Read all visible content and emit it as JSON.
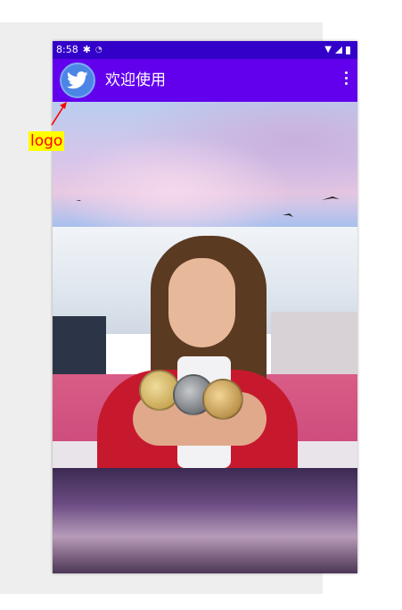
{
  "status_bar": {
    "time": "8:58",
    "icons": [
      "gear-icon",
      "wifi-small-icon",
      "wifi-icon",
      "signal-icon",
      "battery-icon"
    ]
  },
  "app_bar": {
    "title": "欢迎使用",
    "logo_icon": "twitter-bird-icon",
    "overflow_icon": "more-vert-icon"
  },
  "annotation": {
    "label": "logo"
  },
  "colors": {
    "status_bar": "#3300c9",
    "app_bar": "#6200ee",
    "logo_circle": "#4b86e6",
    "annotation_text": "#ff0000",
    "annotation_bg": "#ffff00"
  }
}
